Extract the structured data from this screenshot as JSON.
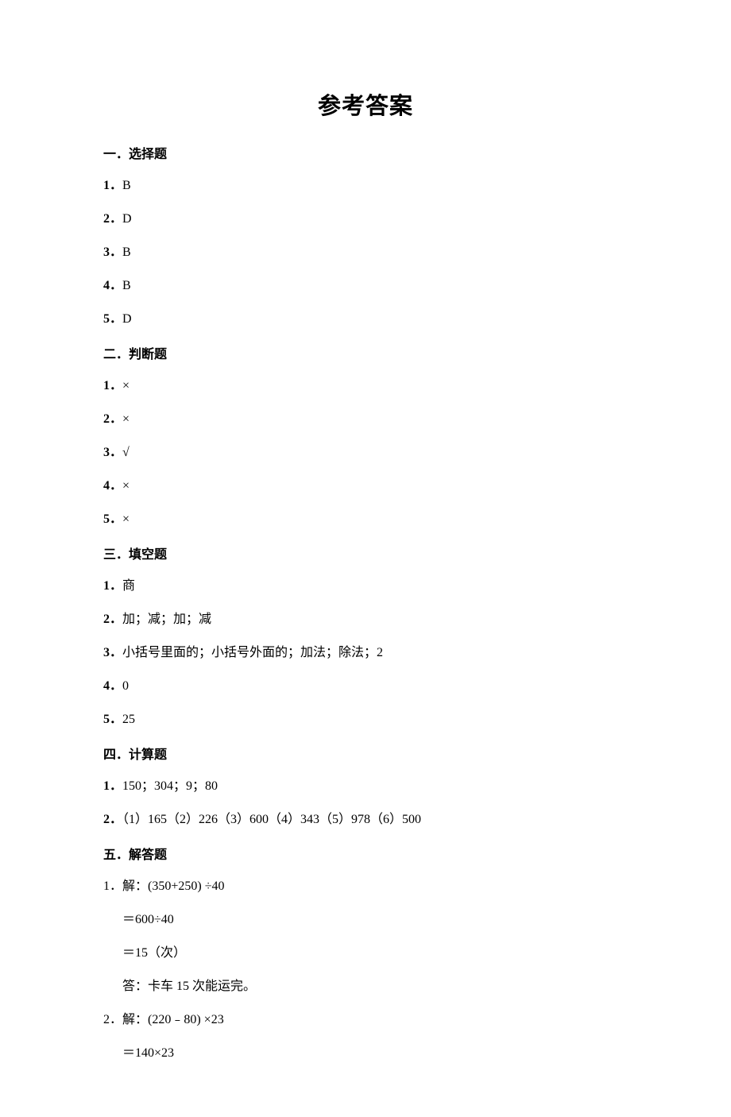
{
  "title": "参考答案",
  "sections": {
    "s1": {
      "header": "一．选择题",
      "items": {
        "i1": {
          "num": "1．",
          "val": "B"
        },
        "i2": {
          "num": "2．",
          "val": "D"
        },
        "i3": {
          "num": "3．",
          "val": "B"
        },
        "i4": {
          "num": "4．",
          "val": "B"
        },
        "i5": {
          "num": "5．",
          "val": "D"
        }
      }
    },
    "s2": {
      "header": "二．判断题",
      "items": {
        "i1": {
          "num": "1．",
          "val": "×"
        },
        "i2": {
          "num": "2．",
          "val": "×"
        },
        "i3": {
          "num": "3．",
          "val": "√"
        },
        "i4": {
          "num": "4．",
          "val": "×"
        },
        "i5": {
          "num": "5．",
          "val": "×"
        }
      }
    },
    "s3": {
      "header": "三．填空题",
      "items": {
        "i1": {
          "num": "1．",
          "val": "商"
        },
        "i2": {
          "num": "2．",
          "val": "加；减；加；减"
        },
        "i3": {
          "num": "3．",
          "val": "小括号里面的；小括号外面的；加法；除法；2"
        },
        "i4": {
          "num": "4．",
          "val": "0"
        },
        "i5": {
          "num": "5．",
          "val": "25"
        }
      }
    },
    "s4": {
      "header": "四．计算题",
      "items": {
        "i1": {
          "num": "1．",
          "val": "150；304；9；80"
        },
        "i2": {
          "num": "2．",
          "val": "（1）165（2）226（3）600（4）343（5）978（6）500"
        }
      }
    },
    "s5": {
      "header": "五．解答题",
      "problems": {
        "p1": {
          "num": "1．",
          "line1": "解：(350+250) ÷40",
          "line2": "＝600÷40",
          "line3": "＝15（次）",
          "line4": "答：卡车 15 次能运完。"
        },
        "p2": {
          "num": "2．",
          "line1": "解：(220﹣80) ×23",
          "line2": "＝140×23"
        }
      }
    }
  }
}
